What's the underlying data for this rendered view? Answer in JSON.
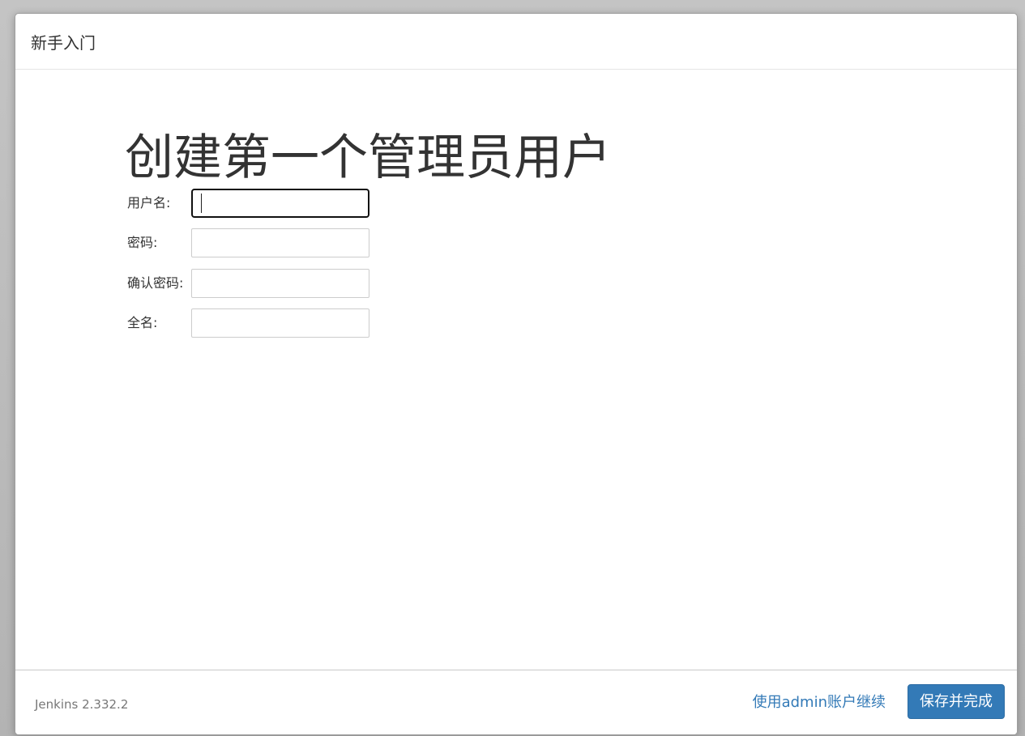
{
  "dialog": {
    "title": "新手入门"
  },
  "page": {
    "heading": "创建第一个管理员用户"
  },
  "form": {
    "fields": [
      {
        "label": "用户名:",
        "value": ""
      },
      {
        "label": "密码:",
        "value": ""
      },
      {
        "label": "确认密码:",
        "value": ""
      },
      {
        "label": "全名:",
        "value": ""
      }
    ]
  },
  "footer": {
    "version": "Jenkins 2.332.2",
    "continue_link": "使用admin账户继续",
    "save_button": "保存并完成"
  },
  "colors": {
    "accent": "#337ab7",
    "background": "#b8b8b8"
  }
}
